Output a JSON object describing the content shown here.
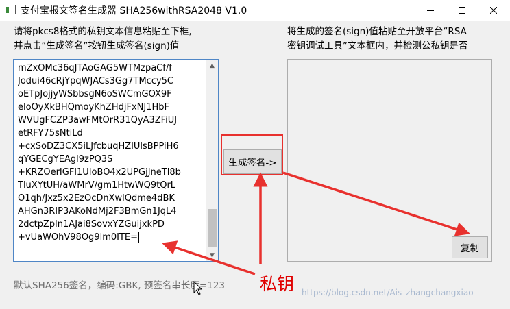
{
  "window": {
    "title": "支付宝报文签名生成器 SHA256withRSA2048 V1.0",
    "controls": {
      "minimize": "—",
      "maximize": "☐",
      "close": "✕"
    }
  },
  "left_instructions": {
    "line1": "请将pkcs8格式的私钥文本信息粘贴至下框,",
    "line2": "并点击“生成签名”按钮生成签名(sign)值"
  },
  "right_instructions": {
    "line1": "将生成的签名(sign)值粘贴至开放平台“RSA",
    "line2": "密钥调试工具”文本框内，并检测公私钥是否"
  },
  "private_key_lines": [
    "mZxOMc36qJTAoGAG5WTMzpaCf/f",
    "Jodui46cRjYpqWJACs3Gg7TMccy5C",
    "oETpJojjyWSbbsgN6oSWCmGOX9F",
    "eloOyXkBHQmoyKhZHdjFxNJ1HbF",
    "WVUgFCZP3awFMtOrR31QyA3ZFiUJ",
    "etRFY75sNtiLd",
    "+cxSoDZ3CX5iLJfcbuqHZlUlsBPPiH6",
    "qYGECgYEAgl9zPQ3S",
    "+KRZOerIGFl1UIoBO4x2UPGjJneTl8b",
    "TluXYtUH/aWMrV/gm1HtwWQ9tQrL",
    "O1qh/Jxz5x2EzOcDnXwlQdme4dBK",
    "AHGn3RIP3AKoNdMj2F3BmGn1JqL4",
    "2dctpZpln1AJai8SovxYZGuijxkPD",
    "+vUaWOhV98Og9lm0ITE="
  ],
  "buttons": {
    "generate": "生成签名->",
    "copy": "复制"
  },
  "status_text": "默认SHA256签名，编码:GBK, 预签名串长度=123",
  "annotation": "私钥",
  "watermark": "https://blog.csdn.net/Ais_zhangchangxiao",
  "colors": {
    "annotation_red": "#e8312e",
    "scroll_thumb": "#c1c1c1",
    "focus_border": "#4f86c6"
  }
}
